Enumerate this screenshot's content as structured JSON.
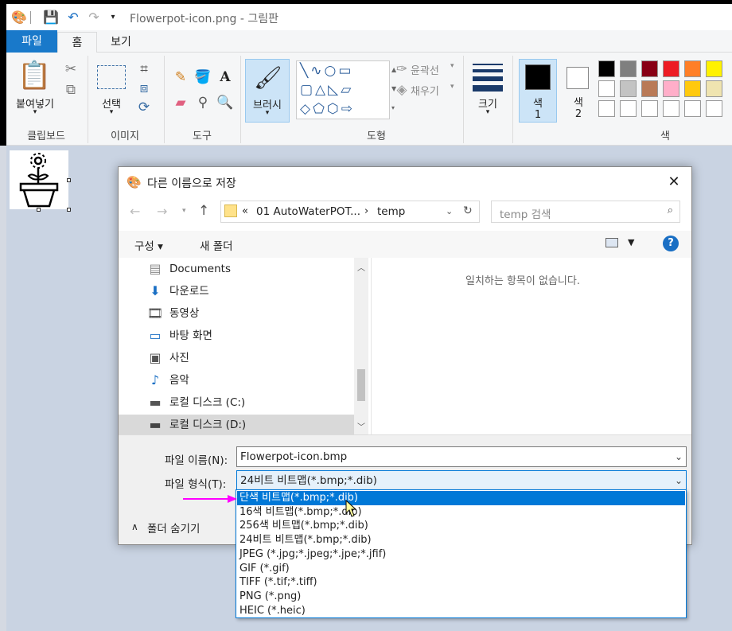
{
  "titlebar": {
    "title": "Flowerpot-icon.png - 그림판"
  },
  "ribbon": {
    "tabs": [
      {
        "label": "파일"
      },
      {
        "label": "홈"
      },
      {
        "label": "보기"
      }
    ],
    "clipboard": {
      "paste_label": "붙여넣기",
      "group_label": "클립보드"
    },
    "image": {
      "select_label": "선택",
      "group_label": "이미지"
    },
    "tools": {
      "group_label": "도구"
    },
    "brush": {
      "label": "브러시"
    },
    "shapes": {
      "group_label": "도형",
      "outline_label": "윤곽선",
      "fill_label": "채우기"
    },
    "size": {
      "label": "크기"
    },
    "color1": {
      "label": "색\n1",
      "l1": "색",
      "l2": "1"
    },
    "color2": {
      "l1": "색",
      "l2": "2"
    },
    "colors": {
      "group_label": "색"
    },
    "palette": [
      "#000000",
      "#7f7f7f",
      "#880015",
      "#ed1c24",
      "#ff7f27",
      "#fff200",
      "#ffffff",
      "#c3c3c3",
      "#b97a57",
      "#ffaec9",
      "#ffc90e",
      "#efe4b0",
      "#ffffff",
      "#ffffff",
      "#ffffff",
      "#ffffff",
      "#ffffff",
      "#ffffff"
    ]
  },
  "dialog": {
    "title": "다른 이름으로 저장",
    "address": {
      "prefix": "«",
      "folder": "01 AutoWaterPOT...",
      "sep": "›",
      "current": "temp"
    },
    "search_placeholder": "temp 검색",
    "cmd": {
      "organize": "구성 ▾",
      "new_folder": "새 폴더"
    },
    "nav_items": [
      {
        "label": "Documents",
        "icon": "documents-icon"
      },
      {
        "label": "다운로드",
        "icon": "download-icon"
      },
      {
        "label": "동영상",
        "icon": "videos-icon"
      },
      {
        "label": "바탕 화면",
        "icon": "desktop-icon"
      },
      {
        "label": "사진",
        "icon": "pictures-icon"
      },
      {
        "label": "음악",
        "icon": "music-icon"
      },
      {
        "label": "로컬 디스크 (C:)",
        "icon": "drive-icon"
      },
      {
        "label": "로컬 디스크 (D:)",
        "icon": "drive-icon"
      }
    ],
    "empty_message": "일치하는 항목이 없습니다.",
    "filename_label": "파일 이름(N):",
    "filename_value": "Flowerpot-icon.bmp",
    "filetype_label": "파일 형식(T):",
    "filetype_value": "24비트 비트맵(*.bmp;*.dib)",
    "hide_folders": "폴더 숨기기"
  },
  "filetype_options": [
    "단색 비트맵(*.bmp;*.dib)",
    "16색 비트맵(*.bmp;*.dib)",
    "256색 비트맵(*.bmp;*.dib)",
    "24비트 비트맵(*.bmp;*.dib)",
    "JPEG (*.jpg;*.jpeg;*.jpe;*.jfif)",
    "GIF (*.gif)",
    "TIFF (*.tif;*.tiff)",
    "PNG (*.png)",
    "HEIC (*.heic)"
  ],
  "selected_option_index": 0,
  "colors": {
    "accent": "#1979ca",
    "selection": "#0078d7",
    "annotation_arrow": "#ff00ff"
  }
}
